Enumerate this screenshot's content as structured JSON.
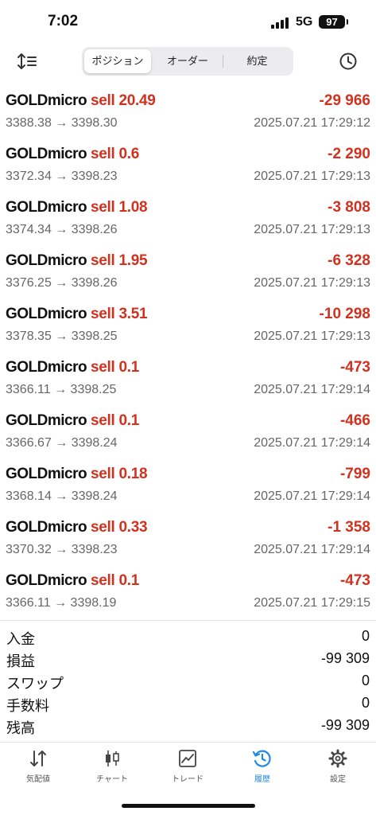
{
  "status_bar": {
    "time": "7:02",
    "network": "5G",
    "battery": "97"
  },
  "toolbar": {
    "sort_icon": "sort-icon",
    "tabs": [
      {
        "label": "ポジション",
        "active": true
      },
      {
        "label": "オーダー",
        "active": false
      },
      {
        "label": "約定",
        "active": false
      }
    ],
    "history_icon": "clock-icon"
  },
  "deals": [
    {
      "symbol": "GOLDmicro",
      "side": "sell 20.49",
      "profit": "-29 966",
      "open_price": "3388.38",
      "close_price": "3398.30",
      "time": "2025.07.21 17:29:12"
    },
    {
      "symbol": "GOLDmicro",
      "side": "sell 0.6",
      "profit": "-2 290",
      "open_price": "3372.34",
      "close_price": "3398.23",
      "time": "2025.07.21 17:29:13"
    },
    {
      "symbol": "GOLDmicro",
      "side": "sell 1.08",
      "profit": "-3 808",
      "open_price": "3374.34",
      "close_price": "3398.26",
      "time": "2025.07.21 17:29:13"
    },
    {
      "symbol": "GOLDmicro",
      "side": "sell 1.95",
      "profit": "-6 328",
      "open_price": "3376.25",
      "close_price": "3398.26",
      "time": "2025.07.21 17:29:13"
    },
    {
      "symbol": "GOLDmicro",
      "side": "sell 3.51",
      "profit": "-10 298",
      "open_price": "3378.35",
      "close_price": "3398.25",
      "time": "2025.07.21 17:29:13"
    },
    {
      "symbol": "GOLDmicro",
      "side": "sell 0.1",
      "profit": "-473",
      "open_price": "3366.11",
      "close_price": "3398.25",
      "time": "2025.07.21 17:29:14"
    },
    {
      "symbol": "GOLDmicro",
      "side": "sell 0.1",
      "profit": "-466",
      "open_price": "3366.67",
      "close_price": "3398.24",
      "time": "2025.07.21 17:29:14"
    },
    {
      "symbol": "GOLDmicro",
      "side": "sell 0.18",
      "profit": "-799",
      "open_price": "3368.14",
      "close_price": "3398.24",
      "time": "2025.07.21 17:29:14"
    },
    {
      "symbol": "GOLDmicro",
      "side": "sell 0.33",
      "profit": "-1 358",
      "open_price": "3370.32",
      "close_price": "3398.23",
      "time": "2025.07.21 17:29:14"
    },
    {
      "symbol": "GOLDmicro",
      "side": "sell 0.1",
      "profit": "-473",
      "open_price": "3366.11",
      "close_price": "3398.19",
      "time": "2025.07.21 17:29:15"
    }
  ],
  "summary": [
    {
      "label": "入金",
      "value": "0"
    },
    {
      "label": "損益",
      "value": "-99 309"
    },
    {
      "label": "スワップ",
      "value": "0"
    },
    {
      "label": "手数料",
      "value": "0"
    },
    {
      "label": "残高",
      "value": "-99 309"
    }
  ],
  "tabbar": [
    {
      "label": "気配値",
      "icon": "quotes-icon",
      "active": false
    },
    {
      "label": "チャート",
      "icon": "candlestick-icon",
      "active": false
    },
    {
      "label": "トレード",
      "icon": "trade-chart-icon",
      "active": false
    },
    {
      "label": "履歴",
      "icon": "history-icon",
      "active": true
    },
    {
      "label": "設定",
      "icon": "gear-icon",
      "active": false
    }
  ],
  "colors": {
    "loss_red": "#d0321f",
    "accent_blue": "#1e88e5",
    "muted_gray": "#666666"
  }
}
